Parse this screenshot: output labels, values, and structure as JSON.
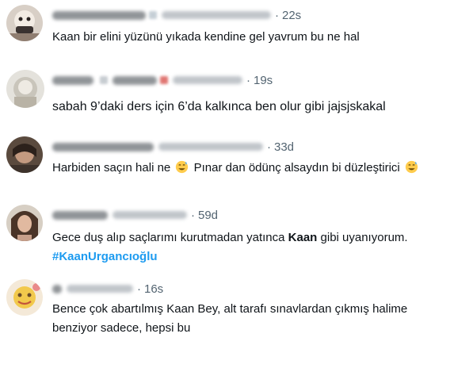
{
  "tweets": [
    {
      "time": "22s",
      "text": "Kaan bir elini yüzünü yıkada kendine gel yavrum bu ne hal"
    },
    {
      "time": "19s",
      "text": "sabah 9’daki ders için 6’da kalkınca ben olur gibi jajsjskakal"
    },
    {
      "time": "33d",
      "text_a": "Harbiden saçın hali ne",
      "text_b": "Pınar dan ödünç alsaydın bi düzleştirici",
      "emoji": "grinning-sweat-emoji"
    },
    {
      "time": "59d",
      "text_a": "Gece duş alıp saçlarımı kurutmadan yatınca",
      "text_bold": "Kaan",
      "text_b": "gibi uyanıyorum.",
      "hashtag": "#KaanUrgancıoğlu"
    },
    {
      "time": "16s",
      "text_line1": "Bence çok abartılmış Kaan Bey, alt tarafı sınavlardan çıkmış halime",
      "text_line2": "benziyor sadece, hepsi bu"
    }
  ],
  "separator": "·",
  "colors": {
    "text": "#0f1419",
    "muted": "#536471",
    "hashtag": "#1d9bf0"
  }
}
